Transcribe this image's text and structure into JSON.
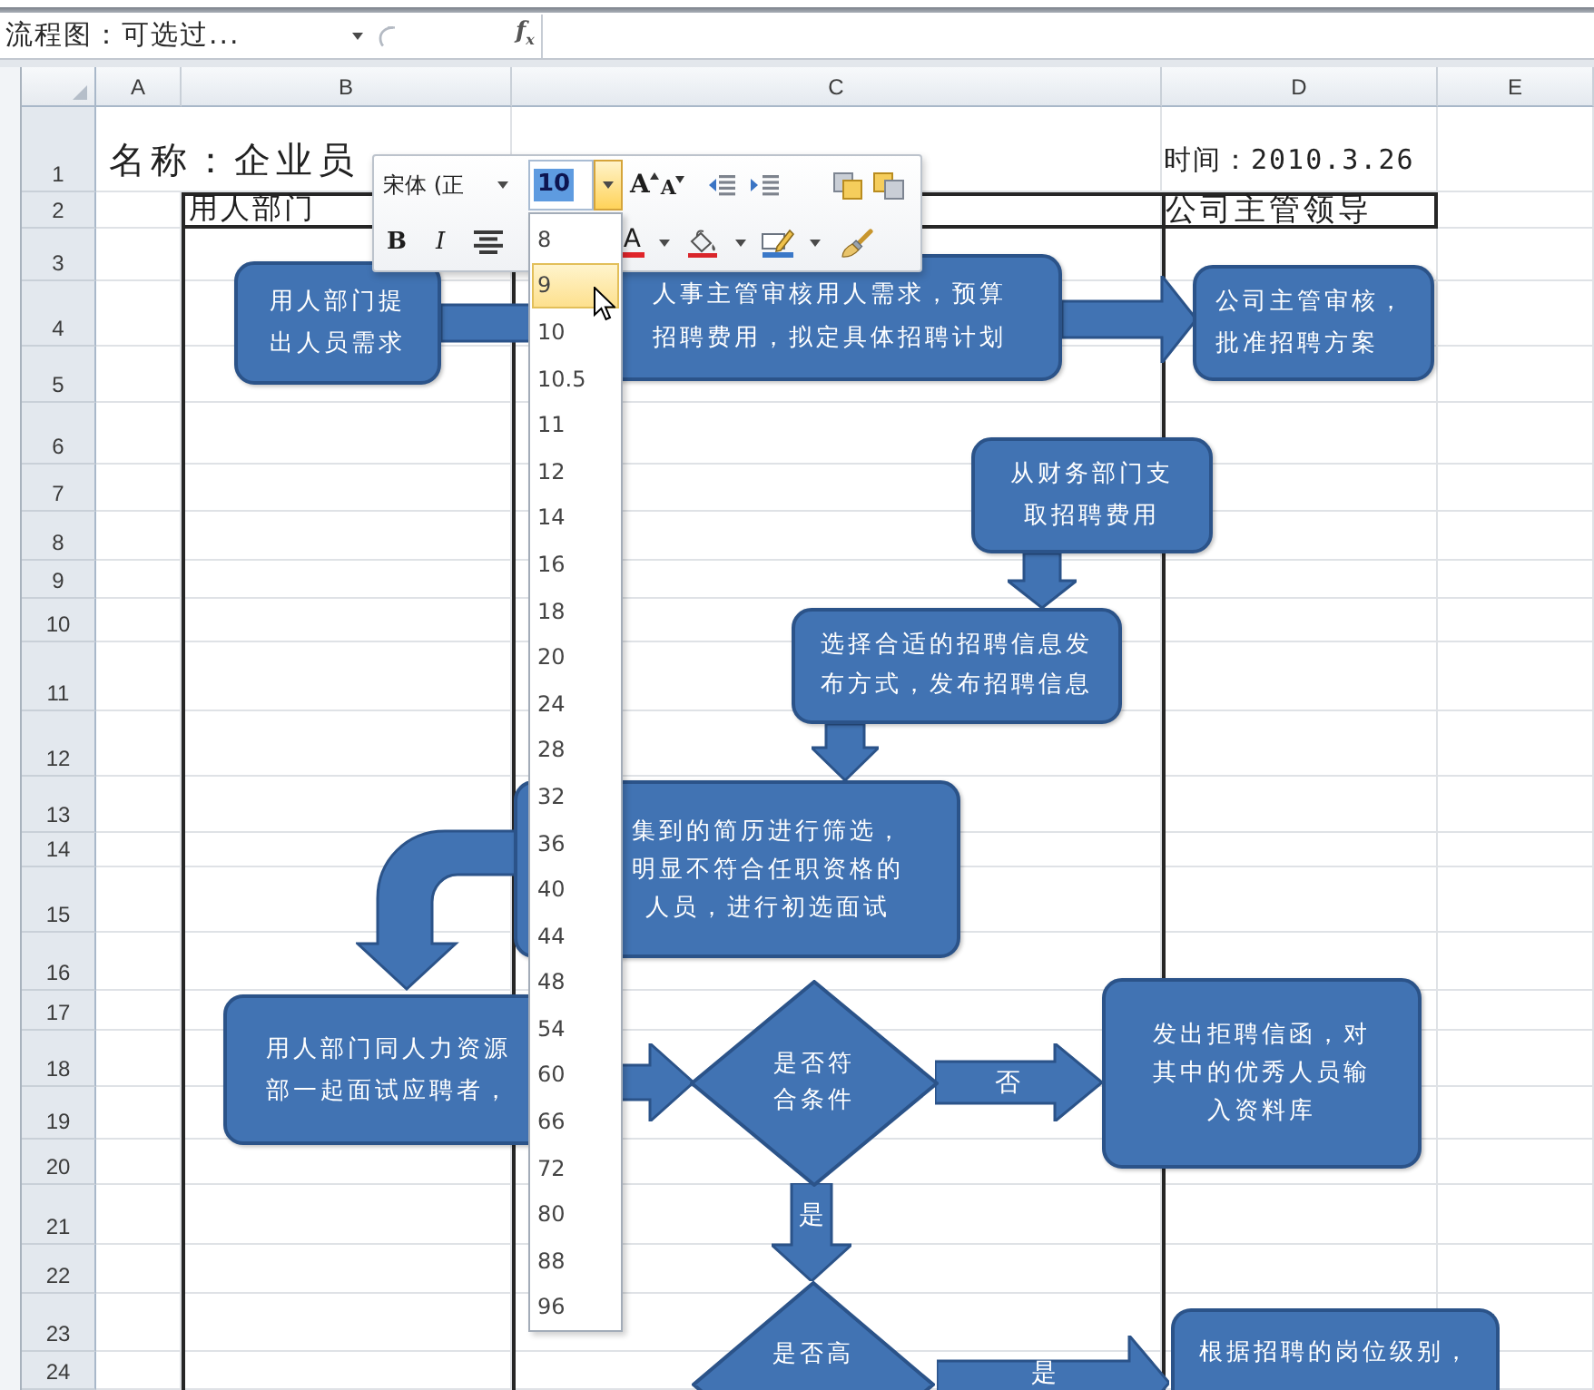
{
  "formula_bar": {
    "name_box": "流程图：可选过...",
    "function_label": "f$_{x}$"
  },
  "sheet": {
    "columns": [
      "A",
      "B",
      "C",
      "D",
      "E"
    ],
    "rows": [
      "1",
      "2",
      "3",
      "4",
      "5",
      "6",
      "7",
      "8",
      "9",
      "10",
      "11",
      "12",
      "13",
      "14",
      "15",
      "16",
      "17",
      "18",
      "19",
      "20",
      "21",
      "22",
      "23",
      "24"
    ],
    "title": "名称：企业员",
    "date": "时间：2010.3.26",
    "lanes": [
      "用人部门",
      "公司主管领导"
    ]
  },
  "flowchart": {
    "nodes": [
      {
        "kind": "process",
        "text": "用人部门提出人员需求"
      },
      {
        "kind": "process",
        "text": "人事主管审核用人需求，预算招聘费用，拟定具体招聘计划"
      },
      {
        "kind": "process",
        "text": "公司主管审核，批准招聘方案"
      },
      {
        "kind": "process",
        "text": "从财务部门支取招聘费用"
      },
      {
        "kind": "process",
        "text": "选择合适的招聘信息发布方式，发布招聘信息"
      },
      {
        "kind": "process",
        "text": "集到的简历进行筛选，明显不符合任职资格的人员，进行初选面试"
      },
      {
        "kind": "process",
        "text": "用人部门同人力资源部一起面试应聘者，"
      },
      {
        "kind": "decision",
        "text": "是否符合条件"
      },
      {
        "kind": "process",
        "text": "发出拒聘信函，对其中的优秀人员输入资料库"
      },
      {
        "kind": "decision",
        "text": "是否高"
      },
      {
        "kind": "process",
        "text": "根据招聘的岗位级别，"
      }
    ],
    "arrows": [
      {
        "kind": "right"
      },
      {
        "kind": "right"
      },
      {
        "kind": "down"
      },
      {
        "kind": "down"
      },
      {
        "kind": "curved"
      },
      {
        "kind": "right"
      },
      {
        "kind": "right",
        "label": "否"
      },
      {
        "kind": "down",
        "label": "是"
      },
      {
        "kind": "right",
        "label": "是"
      }
    ]
  },
  "mini_toolbar": {
    "font_name": "宋体 (正",
    "font_size": "10",
    "font_size_selected": true,
    "top_row": [
      {
        "kind": "grow",
        "glyph": "A"
      },
      {
        "kind": "shrink",
        "glyph": "A"
      },
      {
        "kind": "outdent"
      },
      {
        "kind": "indent"
      },
      {
        "kind": "forward"
      },
      {
        "kind": "backward"
      }
    ],
    "bottom_row": [
      {
        "kind": "bold",
        "glyph": "B"
      },
      {
        "kind": "italic",
        "glyph": "I"
      },
      {
        "kind": "center"
      },
      {
        "kind": "font_color",
        "glyph": "A"
      },
      {
        "kind": "fill"
      },
      {
        "kind": "outline"
      },
      {
        "kind": "painter"
      }
    ]
  },
  "size_menu": {
    "open": true,
    "options": [
      {
        "label": "8",
        "selected": false
      },
      {
        "label": "9",
        "selected": true
      },
      {
        "label": "10",
        "selected": false
      },
      {
        "label": "10.5",
        "selected": false
      },
      {
        "label": "11",
        "selected": false
      },
      {
        "label": "12",
        "selected": false
      },
      {
        "label": "14",
        "selected": false
      },
      {
        "label": "16",
        "selected": false
      },
      {
        "label": "18",
        "selected": false
      },
      {
        "label": "20",
        "selected": false
      },
      {
        "label": "24",
        "selected": false
      },
      {
        "label": "28",
        "selected": false
      },
      {
        "label": "32",
        "selected": false
      },
      {
        "label": "36",
        "selected": false
      },
      {
        "label": "40",
        "selected": false
      },
      {
        "label": "44",
        "selected": false
      },
      {
        "label": "48",
        "selected": false
      },
      {
        "label": "54",
        "selected": false
      },
      {
        "label": "60",
        "selected": false
      },
      {
        "label": "66",
        "selected": false
      },
      {
        "label": "72",
        "selected": false
      },
      {
        "label": "80",
        "selected": false
      },
      {
        "label": "88",
        "selected": false
      },
      {
        "label": "96",
        "selected": false
      }
    ]
  }
}
